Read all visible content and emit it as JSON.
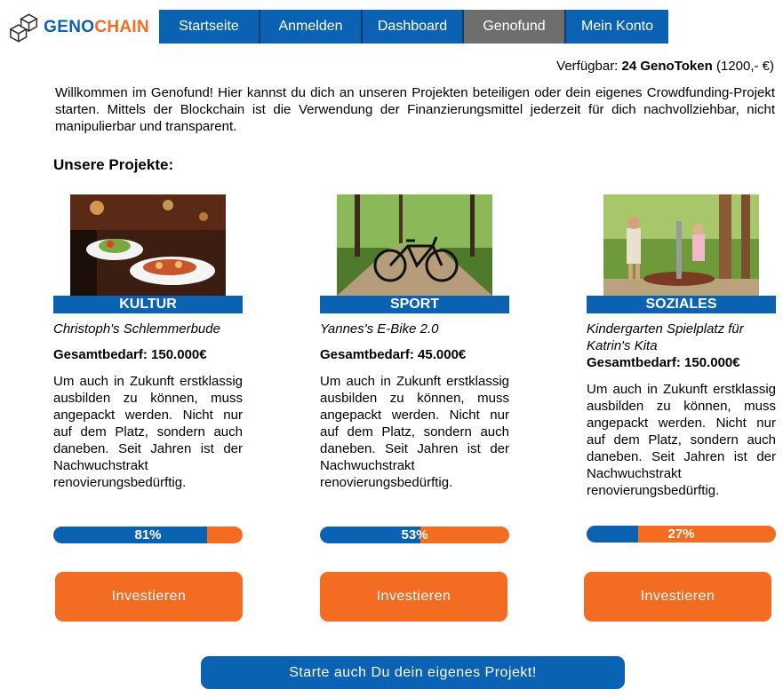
{
  "logo": {
    "part1": "GENO",
    "part2": "CHAIN"
  },
  "nav": {
    "items": [
      {
        "label": "Startseite"
      },
      {
        "label": "Anmelden"
      },
      {
        "label": "Dashboard"
      },
      {
        "label": "Genofund",
        "active": true
      },
      {
        "label": "Mein Konto"
      }
    ]
  },
  "balance": {
    "prefix": "Verfügbar:",
    "amount": "24 GenoToken",
    "euro": "(1200,- €)"
  },
  "intro": "Willkommen im Genofund! Hier kannst du dich an unseren Projekten beteiligen oder dein eigenes Crowdfunding-Projekt starten. Mittels der Blockchain ist die Verwendung der Finanzierungsmittel jederzeit für dich nachvollziehbar, nicht manipulierbar und transparent.",
  "projects_title": "Unsere Projekte:",
  "projects": [
    {
      "category": "KULTUR",
      "name": "Christoph's Schlemmerbude",
      "need": "Gesamtbedarf: 150.000€",
      "description": "Um auch in Zukunft erstklassig ausbilden zu können, muss angepackt werden. Nicht nur auf dem Platz, sondern auch daneben. Seit Jahren ist der Nachwuchstrakt renovierungsbedürftig.",
      "progress": 0.81,
      "progress_label": "81%",
      "button": "Investieren"
    },
    {
      "category": "SPORT",
      "name": "Yannes's E-Bike 2.0",
      "need": "Gesamtbedarf:  45.000€",
      "description": "Um auch in Zukunft erstklassig ausbilden zu können, muss angepackt werden. Nicht nur auf dem Platz, sondern auch daneben. Seit Jahren ist der Nachwuchstrakt renovierungsbedürftig.",
      "progress": 0.53,
      "progress_label": "53%",
      "button": "Investieren"
    },
    {
      "category": "SOZIALES",
      "name": "Kindergarten Spielplatz für Katrin's Kita",
      "need": "Gesamtbedarf: 150.000€",
      "description": "Um auch in Zukunft erstklassig ausbilden zu können, muss angepackt werden. Nicht nur auf dem Platz, sondern auch daneben. Seit Jahren ist der Nachwuchstrakt renovierungsbedürftig.",
      "progress": 0.27,
      "progress_label": "27%",
      "button": "Investieren"
    }
  ],
  "start_button": "Starte auch Du dein eigenes Projekt!",
  "colors": {
    "brand_blue": "#0b62b2",
    "brand_orange": "#f36c21",
    "nav_active": "#6e6e6e"
  }
}
